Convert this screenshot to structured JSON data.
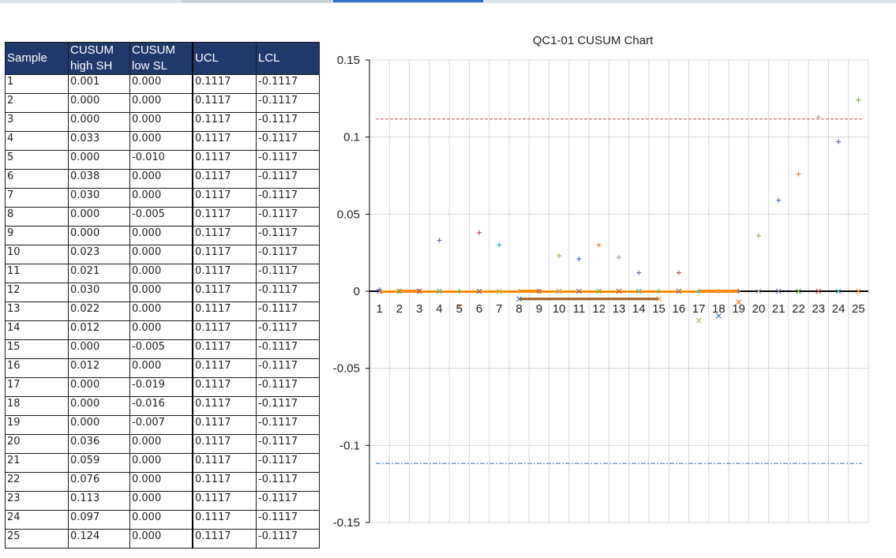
{
  "table": {
    "headers": [
      "Sample",
      "CUSUM high SH",
      "CUSUM low SL",
      "UCL",
      "LCL"
    ],
    "rows": [
      [
        "1",
        "0.001",
        "0.000",
        "0.1117",
        "-0.1117"
      ],
      [
        "2",
        "0.000",
        "0.000",
        "0.1117",
        "-0.1117"
      ],
      [
        "3",
        "0.000",
        "0.000",
        "0.1117",
        "-0.1117"
      ],
      [
        "4",
        "0.033",
        "0.000",
        "0.1117",
        "-0.1117"
      ],
      [
        "5",
        "0.000",
        "-0.010",
        "0.1117",
        "-0.1117"
      ],
      [
        "6",
        "0.038",
        "0.000",
        "0.1117",
        "-0.1117"
      ],
      [
        "7",
        "0.030",
        "0.000",
        "0.1117",
        "-0.1117"
      ],
      [
        "8",
        "0.000",
        "-0.005",
        "0.1117",
        "-0.1117"
      ],
      [
        "9",
        "0.000",
        "0.000",
        "0.1117",
        "-0.1117"
      ],
      [
        "10",
        "0.023",
        "0.000",
        "0.1117",
        "-0.1117"
      ],
      [
        "11",
        "0.021",
        "0.000",
        "0.1117",
        "-0.1117"
      ],
      [
        "12",
        "0.030",
        "0.000",
        "0.1117",
        "-0.1117"
      ],
      [
        "13",
        "0.022",
        "0.000",
        "0.1117",
        "-0.1117"
      ],
      [
        "14",
        "0.012",
        "0.000",
        "0.1117",
        "-0.1117"
      ],
      [
        "15",
        "0.000",
        "-0.005",
        "0.1117",
        "-0.1117"
      ],
      [
        "16",
        "0.012",
        "0.000",
        "0.1117",
        "-0.1117"
      ],
      [
        "17",
        "0.000",
        "-0.019",
        "0.1117",
        "-0.1117"
      ],
      [
        "18",
        "0.000",
        "-0.016",
        "0.1117",
        "-0.1117"
      ],
      [
        "19",
        "0.000",
        "-0.007",
        "0.1117",
        "-0.1117"
      ],
      [
        "20",
        "0.036",
        "0.000",
        "0.1117",
        "-0.1117"
      ],
      [
        "21",
        "0.059",
        "0.000",
        "0.1117",
        "-0.1117"
      ],
      [
        "22",
        "0.076",
        "0.000",
        "0.1117",
        "-0.1117"
      ],
      [
        "23",
        "0.113",
        "0.000",
        "0.1117",
        "-0.1117"
      ],
      [
        "24",
        "0.097",
        "0.000",
        "0.1117",
        "-0.1117"
      ],
      [
        "25",
        "0.124",
        "0.000",
        "0.1117",
        "-0.1117"
      ]
    ]
  },
  "chart_data": {
    "type": "scatter",
    "title": "QC1-01 CUSUM Chart",
    "xlabel": "",
    "ylabel": "",
    "categories": [
      "1",
      "2",
      "3",
      "4",
      "5",
      "6",
      "7",
      "8",
      "9",
      "10",
      "11",
      "12",
      "13",
      "14",
      "15",
      "16",
      "17",
      "18",
      "19",
      "20",
      "21",
      "22",
      "23",
      "24",
      "25"
    ],
    "y_ticks": [
      "0.15",
      "0.1",
      "0.05",
      "0",
      "-0.05",
      "-0.1",
      "-0.15"
    ],
    "ylim": [
      -0.15,
      0.15
    ],
    "grid": true,
    "series": [
      {
        "values": [
          0.001,
          0,
          0,
          0.033,
          0,
          0.038,
          0.03,
          0,
          0,
          0.023,
          0.021,
          0.03,
          0.022,
          0.012,
          0,
          0.012,
          0,
          0,
          0,
          0.036,
          0.059,
          0.076,
          0.113,
          0.097,
          0.124
        ]
      },
      {
        "values": [
          0,
          0,
          0,
          0,
          -0.01,
          0,
          0,
          -0.005,
          0,
          0,
          0,
          0,
          0,
          0,
          -0.005,
          0,
          -0.019,
          -0.016,
          -0.007,
          0,
          0,
          0,
          0,
          0,
          0
        ]
      },
      {
        "values": [
          0.1117,
          0.1117,
          0.1117,
          0.1117,
          0.1117,
          0.1117,
          0.1117,
          0.1117,
          0.1117,
          0.1117,
          0.1117,
          0.1117,
          0.1117,
          0.1117,
          0.1117,
          0.1117,
          0.1117,
          0.1117,
          0.1117,
          0.1117,
          0.1117,
          0.1117,
          0.1117,
          0.1117,
          0.1117
        ]
      },
      {
        "values": [
          -0.1117,
          -0.1117,
          -0.1117,
          -0.1117,
          -0.1117,
          -0.1117,
          -0.1117,
          -0.1117,
          -0.1117,
          -0.1117,
          -0.1117,
          -0.1117,
          -0.1117,
          -0.1117,
          -0.1117,
          -0.1117,
          -0.1117,
          -0.1117,
          -0.1117,
          -0.1117,
          -0.1117,
          -0.1117,
          -0.1117,
          -0.1117,
          -0.1117
        ]
      }
    ],
    "marker_colors": [
      "#4472c4",
      "#ed7d31",
      "#a5a5a5",
      "#8064a2",
      "#70ad47",
      "#c0504d",
      "#4bacc6",
      "#f79646",
      "#7f6084",
      "#9bbb59"
    ],
    "highlight_color": "#ff8c00",
    "ucl_color": "#c0504d",
    "lcl_color": "#4f81bd"
  }
}
